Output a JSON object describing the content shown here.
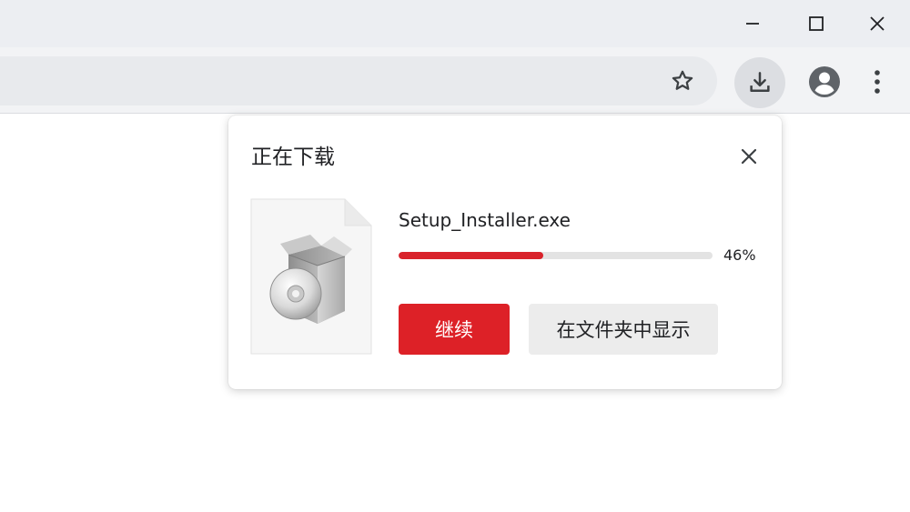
{
  "window": {
    "controls": {
      "minimize_icon": "minimize-icon",
      "maximize_icon": "maximize-icon",
      "close_icon": "close-icon"
    }
  },
  "toolbar": {
    "star_icon": "star-icon",
    "download_icon": "download-icon",
    "profile_icon": "account-circle-icon",
    "menu_icon": "more-vert-icon"
  },
  "download_bubble": {
    "title": "正在下载",
    "close_icon": "close-icon",
    "item": {
      "file_name": "Setup_Installer.exe",
      "progress": 0.46,
      "progress_label": "46%",
      "thumbnail_icon": "installer-package-icon"
    },
    "buttons": {
      "resume": "继续",
      "show_in_folder": "在文件夹中显示"
    }
  },
  "colors": {
    "accent": "#dd2127",
    "progress_fill": "#d9232b",
    "progress_track": "#e3e3e3",
    "titlebar_bg": "#eceef2",
    "toolbar_bg": "#f2f3f5",
    "omnibox_bg": "#e8eaed",
    "secondary_button_bg": "#ececec"
  }
}
